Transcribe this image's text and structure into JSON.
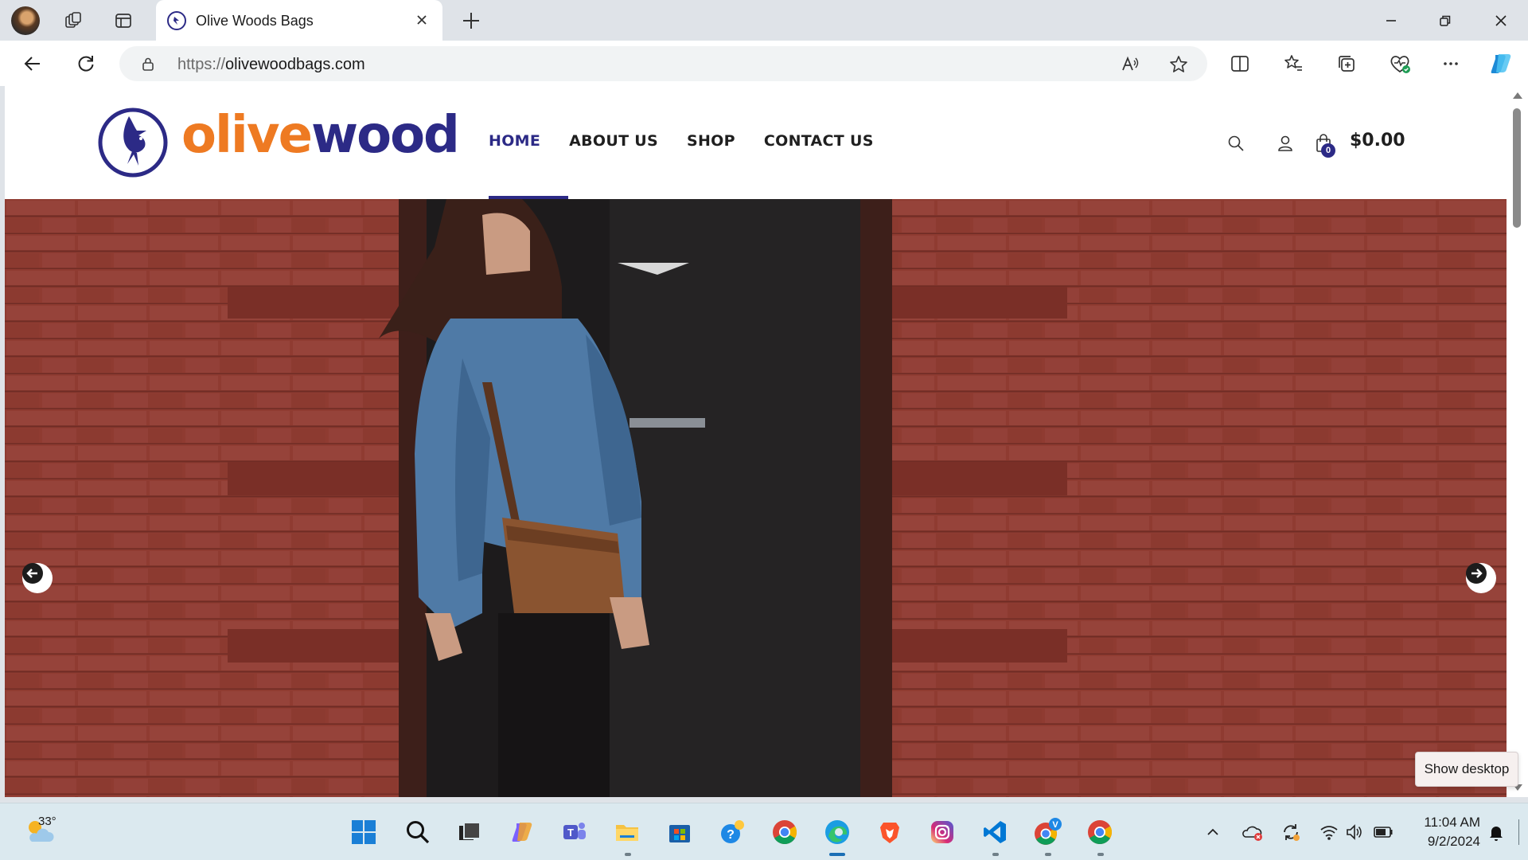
{
  "browser": {
    "tab": {
      "title": "Olive Woods Bags"
    },
    "address": {
      "protocol": "https://",
      "host": "olivewoodbags.com"
    }
  },
  "site": {
    "logo": {
      "part1": "olive",
      "part2": "wood"
    },
    "nav": [
      {
        "label": "HOME",
        "active": true
      },
      {
        "label": "ABOUT US"
      },
      {
        "label": "SHOP"
      },
      {
        "label": "CONTACT US"
      }
    ],
    "cart": {
      "count": "0",
      "total": "$0.00"
    },
    "colors": {
      "brand_blue": "#2c2a86",
      "brand_orange": "#ee7a22"
    }
  },
  "tooltip": {
    "text": "Show desktop"
  },
  "taskbar": {
    "weather_temp": "33°",
    "clock": {
      "time": "11:04 AM",
      "date": "9/2/2024"
    },
    "apps": [
      "start-icon",
      "search-icon",
      "task-view-icon",
      "copilot-icon",
      "teams-icon",
      "file-explorer-icon",
      "store-icon",
      "tips-icon",
      "chrome-icon",
      "edge-icon",
      "brave-icon",
      "instagram-icon",
      "vscode-icon",
      "chrome-profile-v-icon",
      "chrome-icon"
    ]
  }
}
